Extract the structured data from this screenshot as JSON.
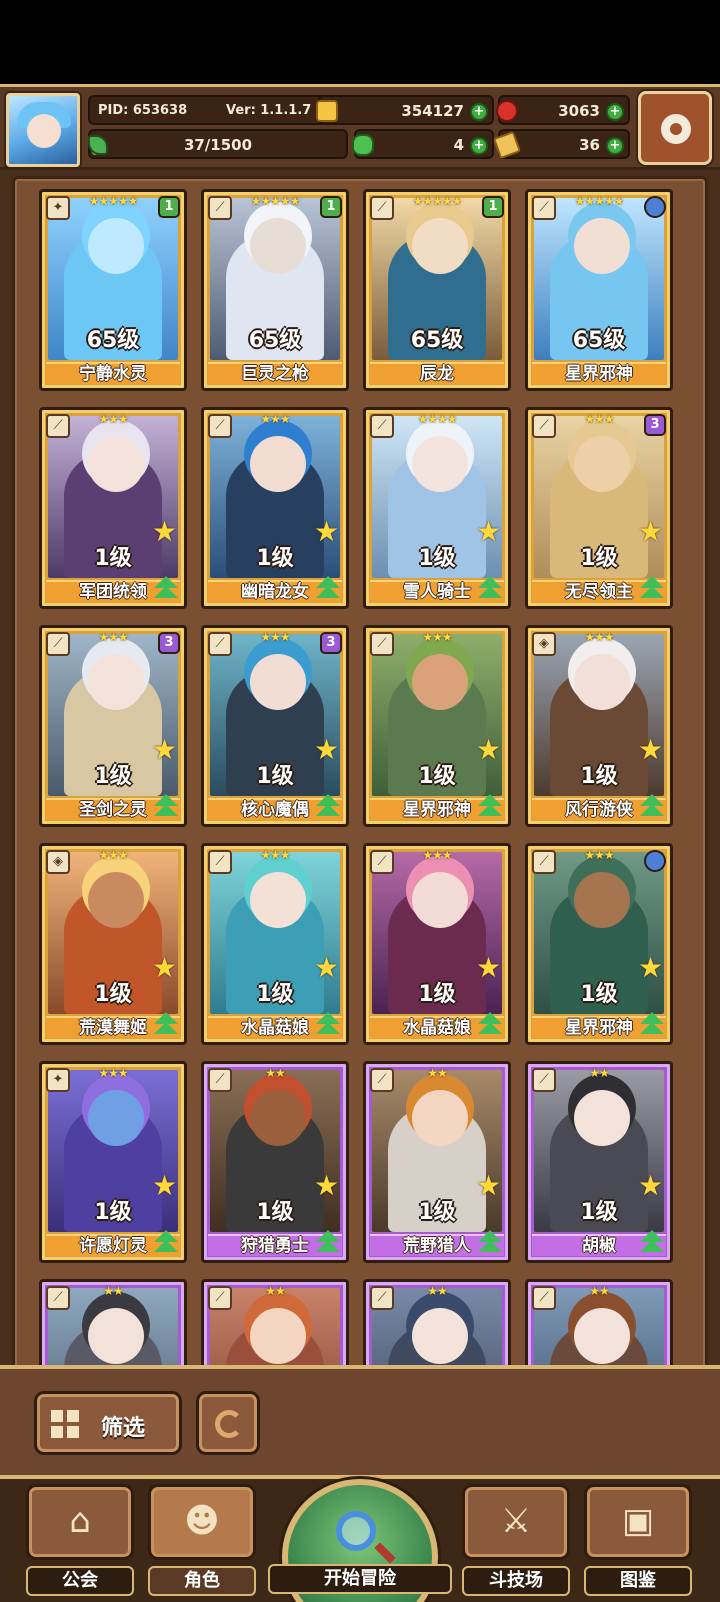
{
  "header": {
    "pid": "PID: 653638",
    "version": "Ver: 1.1.1.7",
    "exp_text": "37/1500",
    "exp_fraction": 0.025,
    "gold": "354127",
    "ruby": "3063",
    "clover": "4",
    "ticket": "36",
    "plus": "+"
  },
  "cards": [
    {
      "name": "宁静水灵",
      "level": "65级",
      "stars": "★★★★★",
      "badge": "1",
      "frame": "gold"
    },
    {
      "name": "巨灵之枪",
      "level": "65级",
      "stars": "★★★★★",
      "badge": "1",
      "frame": "gold"
    },
    {
      "name": "辰龙",
      "level": "65级",
      "stars": "★★★★★",
      "badge": "1",
      "frame": "gold"
    },
    {
      "name": "星界邪神",
      "level": "65级",
      "stars": "★★★★★",
      "badge": "",
      "frame": "gold"
    },
    {
      "name": "军团统领",
      "level": "1级",
      "stars": "★★★",
      "badge": "",
      "frame": "gold"
    },
    {
      "name": "幽暗龙女",
      "level": "1级",
      "stars": "★★★",
      "badge": "",
      "frame": "gold"
    },
    {
      "name": "雪人骑士",
      "level": "1级",
      "stars": "★★★★",
      "badge": "",
      "frame": "gold"
    },
    {
      "name": "无尽领主",
      "level": "1级",
      "stars": "★★★",
      "badge": "3",
      "frame": "gold"
    },
    {
      "name": "圣剑之灵",
      "level": "1级",
      "stars": "★★★",
      "badge": "3",
      "frame": "gold"
    },
    {
      "name": "核心魔偶",
      "level": "1级",
      "stars": "★★★",
      "badge": "3",
      "frame": "gold"
    },
    {
      "name": "星界邪神",
      "level": "1级",
      "stars": "★★★",
      "badge": "",
      "frame": "gold"
    },
    {
      "name": "风行游侠",
      "level": "1级",
      "stars": "★★★",
      "badge": "",
      "frame": "gold"
    },
    {
      "name": "荒漠舞姬",
      "level": "1级",
      "stars": "★★★",
      "badge": "",
      "frame": "gold"
    },
    {
      "name": "水晶菇娘",
      "level": "1级",
      "stars": "★★★",
      "badge": "",
      "frame": "gold"
    },
    {
      "name": "水晶菇娘",
      "level": "1级",
      "stars": "★★★",
      "badge": "",
      "frame": "gold"
    },
    {
      "name": "星界邪神",
      "level": "1级",
      "stars": "★★★",
      "badge": "",
      "frame": "gold"
    },
    {
      "name": "许愿灯灵",
      "level": "1级",
      "stars": "★★★",
      "badge": "",
      "frame": "gold"
    },
    {
      "name": "狩猎勇士",
      "level": "1级",
      "stars": "★★",
      "badge": "",
      "frame": "purple"
    },
    {
      "name": "荒野猎人",
      "level": "1级",
      "stars": "★★",
      "badge": "",
      "frame": "purple"
    },
    {
      "name": "胡椒",
      "level": "1级",
      "stars": "★★",
      "badge": "",
      "frame": "purple"
    },
    {
      "name": "",
      "level": "",
      "stars": "★★",
      "badge": "",
      "frame": "purple"
    },
    {
      "name": "",
      "level": "",
      "stars": "★★",
      "badge": "",
      "frame": "purple"
    },
    {
      "name": "",
      "level": "",
      "stars": "★★",
      "badge": "",
      "frame": "purple"
    },
    {
      "name": "",
      "level": "",
      "stars": "★★",
      "badge": "",
      "frame": "purple"
    }
  ],
  "toolbar": {
    "filter_label": "筛选"
  },
  "nav": {
    "guild": "公会",
    "character": "角色",
    "adventure": "开始冒险",
    "arena": "斗技场",
    "codex": "图鉴"
  }
}
